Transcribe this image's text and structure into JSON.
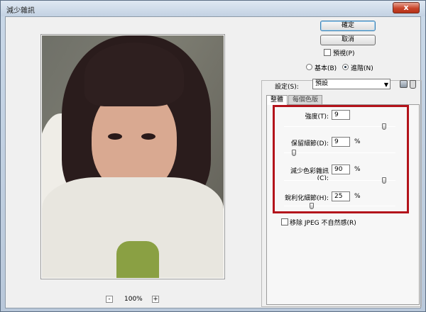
{
  "window": {
    "title": "減少雜訊",
    "close_label": "x"
  },
  "buttons": {
    "ok": "確定",
    "cancel": "取消"
  },
  "preview": {
    "checkbox_label": "預視(P)",
    "checked": false
  },
  "mode": {
    "basic_label": "基本(B)",
    "advanced_label": "進階(N)",
    "selected": "advanced"
  },
  "settings": {
    "label": "設定(S):",
    "value": "預設"
  },
  "tabs": [
    {
      "label": "整體"
    },
    {
      "label": "每個色版"
    }
  ],
  "fields": [
    {
      "label": "強度(T):",
      "value": "9",
      "unit": "",
      "slider": 0.9
    },
    {
      "label": "保留細節(D):",
      "value": "9",
      "unit": "%",
      "slider": 0.09
    },
    {
      "label": "減少色彩雜訊(C):",
      "value": "90",
      "unit": "%",
      "slider": 0.9
    },
    {
      "label": "銳利化細節(H):",
      "value": "25",
      "unit": "%",
      "slider": 0.25
    }
  ],
  "remove_jpeg": {
    "label": "移除 JPEG 不自然感(R)",
    "checked": false
  },
  "zoom": {
    "minus": "-",
    "plus": "+",
    "value": "100%"
  },
  "colors": {
    "highlight": "#b3131b"
  }
}
